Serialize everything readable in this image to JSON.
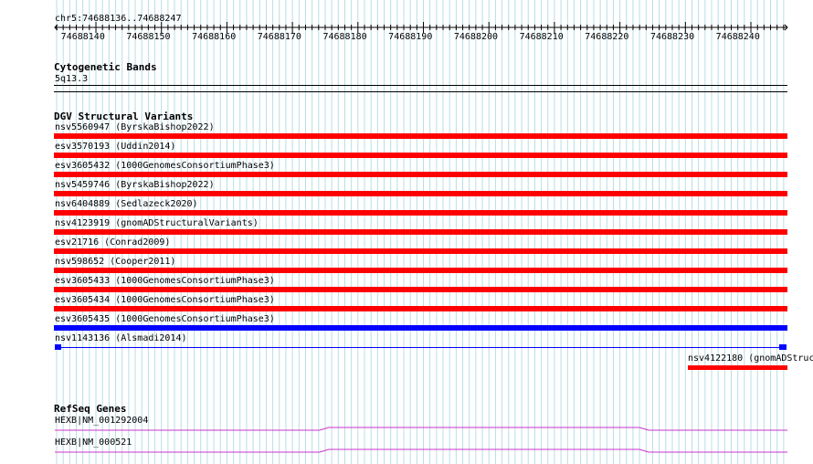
{
  "ruler": {
    "locus": "chr5:74688136..74688247",
    "ticks": [
      "74688140",
      "74688150",
      "74688160",
      "74688170",
      "74688180",
      "74688190",
      "74688200",
      "74688210",
      "74688220",
      "74688230",
      "74688240"
    ]
  },
  "cytobands": {
    "title": "Cytogenetic Bands",
    "band": "5q13.3"
  },
  "dgv": {
    "title": "DGV Structural Variants",
    "variants": [
      {
        "label": "nsv5560947 (ByrskaBishop2022)",
        "color": "#000000"
      },
      {
        "label": "esv3570193 (Uddin2014)",
        "color": "#ff0000"
      },
      {
        "label": "esv3605432 (1000GenomesConsortiumPhase3)",
        "color": "#ff0000"
      },
      {
        "label": "nsv5459746 (ByrskaBishop2022)",
        "color": "#ff0000"
      },
      {
        "label": "nsv6404889 (Sedlazeck2020)",
        "color": "#ff0000"
      },
      {
        "label": "nsv4123919 (gnomADStructuralVariants)",
        "color": "#ff0000"
      },
      {
        "label": "esv21716 (Conrad2009)",
        "color": "#ff0000"
      },
      {
        "label": "nsv598652 (Cooper2011)",
        "color": "#ff0000"
      },
      {
        "label": "esv3605433 (1000GenomesConsortiumPhase3)",
        "color": "#ff0000"
      },
      {
        "label": "esv3605434 (1000GenomesConsortiumPhase3)",
        "color": "#ff0000"
      },
      {
        "label": "esv3605435 (1000GenomesConsortiumPhase3)",
        "color": "#ff0000"
      },
      {
        "label": "nsv1143136 (Alsmadi2014)",
        "color": "#0000ff"
      }
    ],
    "extra_variant": {
      "label": "nsv4122180 (gnomADStruc",
      "color": "#ff0000"
    }
  },
  "refseq": {
    "title": "RefSeq Genes",
    "genes": [
      {
        "label": "HEXB|NM_001292004",
        "color": "#cc33cc"
      },
      {
        "label": "HEXB|NM_000521",
        "color": "#cc33cc"
      }
    ]
  }
}
